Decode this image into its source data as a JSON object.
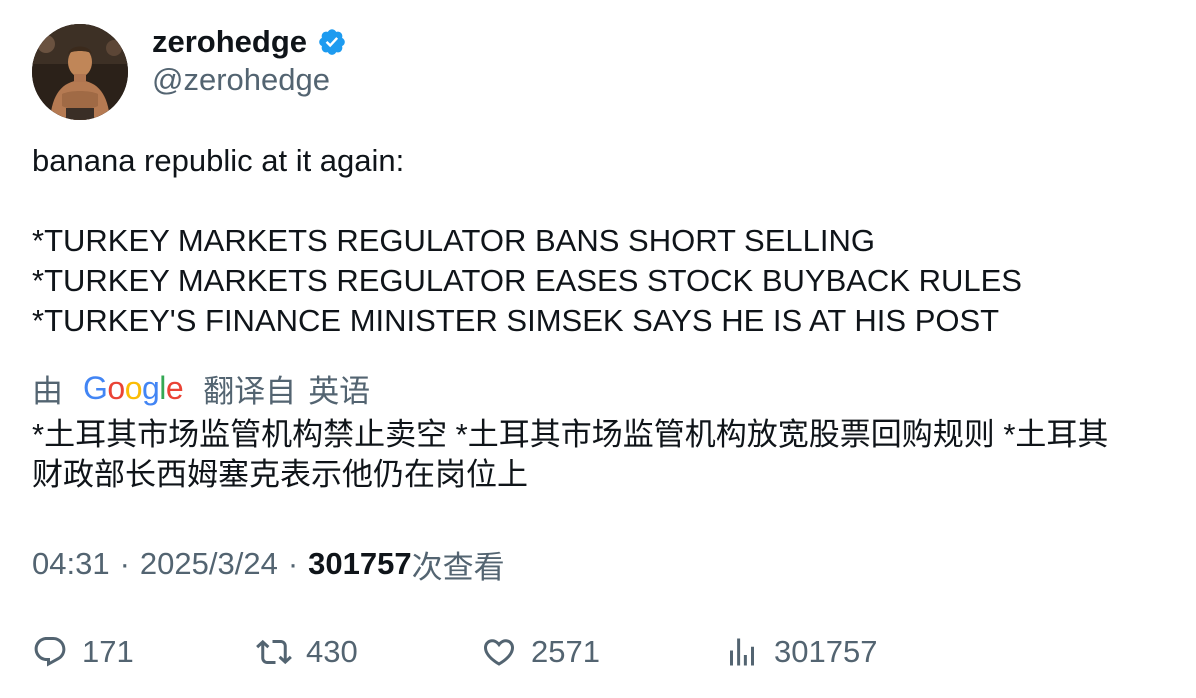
{
  "author": {
    "display_name": "zerohedge",
    "handle": "@zerohedge",
    "verified": true,
    "verified_icon": "verified-badge-icon",
    "verified_color": "#1d9bf0"
  },
  "tweet": {
    "lines": [
      "banana republic at it again:",
      "",
      "*TURKEY MARKETS REGULATOR BANS SHORT SELLING",
      "*TURKEY MARKETS REGULATOR EASES STOCK BUYBACK RULES",
      "*TURKEY'S FINANCE MINISTER SIMSEK SAYS HE IS AT HIS POST"
    ]
  },
  "translation": {
    "by_label": "由",
    "provider": "Google",
    "from_label": "翻译自",
    "language": "英语",
    "lines": [
      "*土耳其市场监管机构禁止卖空 *土耳其市场监管机构放宽股票回购规则 *土耳其",
      "财政部长西姆塞克表示他仍在岗位上"
    ]
  },
  "meta": {
    "time": "04:31",
    "separator": "·",
    "date": "2025/3/24",
    "views_count": "301757",
    "views_label": "次查看"
  },
  "actions": {
    "replies": {
      "icon": "reply-icon",
      "count": "171"
    },
    "retweets": {
      "icon": "retweet-icon",
      "count": "430"
    },
    "likes": {
      "icon": "heart-icon",
      "count": "2571"
    },
    "views": {
      "icon": "analytics-icon",
      "count": "301757"
    }
  },
  "colors": {
    "text": "#0f1419",
    "secondary": "#536471",
    "accent": "#1d9bf0"
  }
}
